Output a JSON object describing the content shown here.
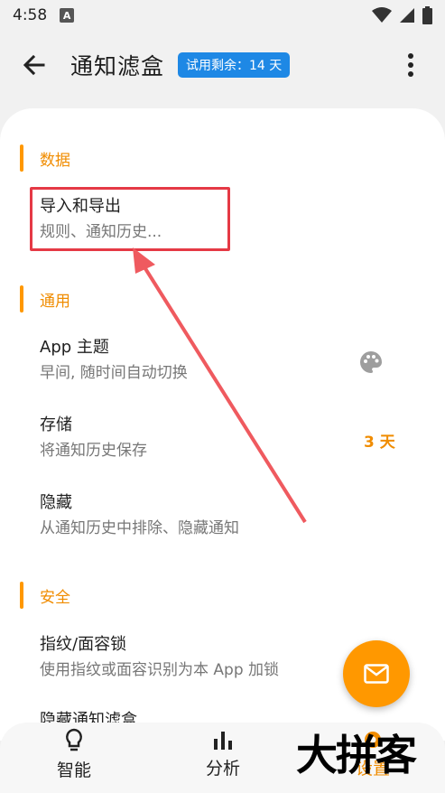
{
  "status_bar": {
    "time": "4:58",
    "notification_badge": "A"
  },
  "app_bar": {
    "title": "通知滤盒",
    "trial_badge": "试用剩余：14 天"
  },
  "sections": {
    "data": {
      "label": "数据"
    },
    "general": {
      "label": "通用"
    },
    "security": {
      "label": "安全"
    }
  },
  "items": {
    "import_export": {
      "title": "导入和导出",
      "subtitle": "规则、通知历史..."
    },
    "theme": {
      "title": "App 主题",
      "subtitle": "早间, 随时间自动切换"
    },
    "storage": {
      "title": "存储",
      "subtitle": "将通知历史保存",
      "value": "3 天"
    },
    "hide": {
      "title": "隐藏",
      "subtitle": "从通知历史中排除、隐藏通知"
    },
    "lock": {
      "title": "指纹/面容锁",
      "subtitle": "使用指纹或面容识别为本 App 加锁"
    },
    "hide_app": {
      "title": "隐藏通知滤盒"
    }
  },
  "bottom_nav": [
    {
      "label": "智能",
      "icon": "lightbulb-icon"
    },
    {
      "label": "分析",
      "icon": "bar-chart-icon"
    },
    {
      "label": "设置",
      "icon": "settings-icon"
    }
  ],
  "watermark": "大拼客",
  "colors": {
    "accent": "#ff9800",
    "badge": "#1e88e5",
    "highlight": "#e53945"
  }
}
